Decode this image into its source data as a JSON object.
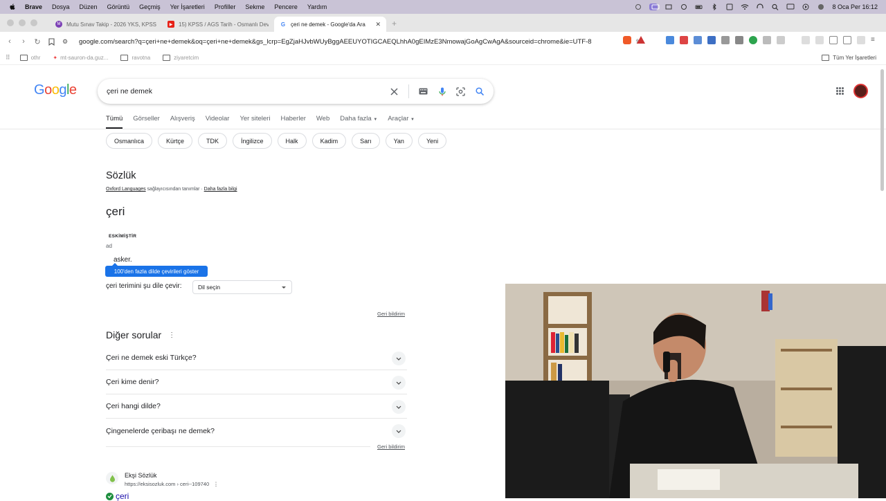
{
  "menubar": {
    "app": "Brave",
    "items": [
      "Dosya",
      "Düzen",
      "Görüntü",
      "Geçmiş",
      "Yer İşaretleri",
      "Profiller",
      "Sekme",
      "Pencere",
      "Yardım"
    ],
    "clock": "8 Oca Per  16:12"
  },
  "tabs": [
    {
      "title": "Mutu Sınav Takip - 2026 YKS, KPSS",
      "fav_color": "#7b3fb5",
      "fav_letter": "M"
    },
    {
      "title": "15) KPSS / AGS Tarih - Osmanlı Devleti",
      "fav_color": "#e62117",
      "fav_letter": "▶"
    },
    {
      "title": "çeri ne demek - Google'da Ara",
      "fav_color": "#4285f4",
      "fav_letter": "G"
    }
  ],
  "url": "google.com/search?q=çeri+ne+demek&oq=çeri+ne+demek&gs_lcrp=EgZjaHJvbWUyBggAEEUYOTIGCAEQLhhA0gEIMzE3NmowajGoAgCwAgA&sourceid=chrome&ie=UTF-8",
  "bookmarks": [
    "othr",
    "mt-sauron-da.guz...",
    "ravotna",
    "ziyaretcim"
  ],
  "all_bookmarks": "Tüm Yer İşaretleri",
  "search": {
    "query": "çeri ne demek"
  },
  "nav_tabs": [
    "Tümü",
    "Görseller",
    "Alışveriş",
    "Videolar",
    "Yer siteleri",
    "Haberler",
    "Web",
    "Daha fazla",
    "Araçlar"
  ],
  "chips": [
    "Osmanlıca",
    "Kürtçe",
    "TDK",
    "İngilizce",
    "Halk",
    "Kadim",
    "Sarı",
    "Yan",
    "Yeni"
  ],
  "dictionary": {
    "heading": "Sözlük",
    "source_link": "Oxford Languages",
    "source_text": " sağlayıcısından tanımlar · ",
    "more_link": "Daha fazla bilgi",
    "word": "çeri",
    "label": "ESKİMİŞTİR",
    "pos": "ad",
    "definition": "asker.",
    "translate_button": "100'den fazla dilde çevirileri göster",
    "translate_label": "çeri terimini şu dile çevir:",
    "language_select": "Dil seçin",
    "feedback": "Geri bildirim"
  },
  "other_questions": {
    "heading": "Diğer sorular",
    "items": [
      "Çeri ne demek eski Türkçe?",
      "Çeri kime denir?",
      "Çeri hangi dilde?",
      "Çingenelerde çeribaşı ne demek?"
    ],
    "feedback": "Geri bildirim"
  },
  "result": {
    "site": "Ekşi Sözlük",
    "url": "https://eksisozluk.com › ceri--109740",
    "title": "çeri"
  }
}
